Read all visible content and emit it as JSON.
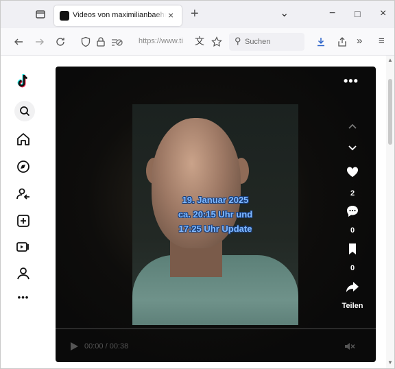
{
  "browser": {
    "tab_title": "Videos von maximilianbaehring",
    "tab_close": "×",
    "new_tab": "+",
    "list_tabs": "⌄",
    "minimize": "−",
    "maximize": "□",
    "close": "×",
    "url": "https://www.ti",
    "search_placeholder": "Suchen",
    "more_tools": "»",
    "menu": "≡"
  },
  "video": {
    "overlay_lines": [
      "19. Januar 2025",
      "ca. 20:15 Uhr und",
      "17:25 Uhr Update"
    ],
    "more_label": "•••",
    "likes": "2",
    "comments": "0",
    "saves": "0",
    "share_label": "Teilen",
    "time": "00:00 / 00:38"
  },
  "sidebar": {
    "items": [
      "tiktok-logo",
      "search",
      "home",
      "explore",
      "following",
      "upload",
      "live",
      "profile",
      "more"
    ],
    "more_label": "•••"
  },
  "colors": {
    "overlay_text": "#7fb8ff",
    "video_bg": "#0a0a0a",
    "tiktok_cyan": "#25f4ee",
    "tiktok_red": "#fe2c55"
  }
}
